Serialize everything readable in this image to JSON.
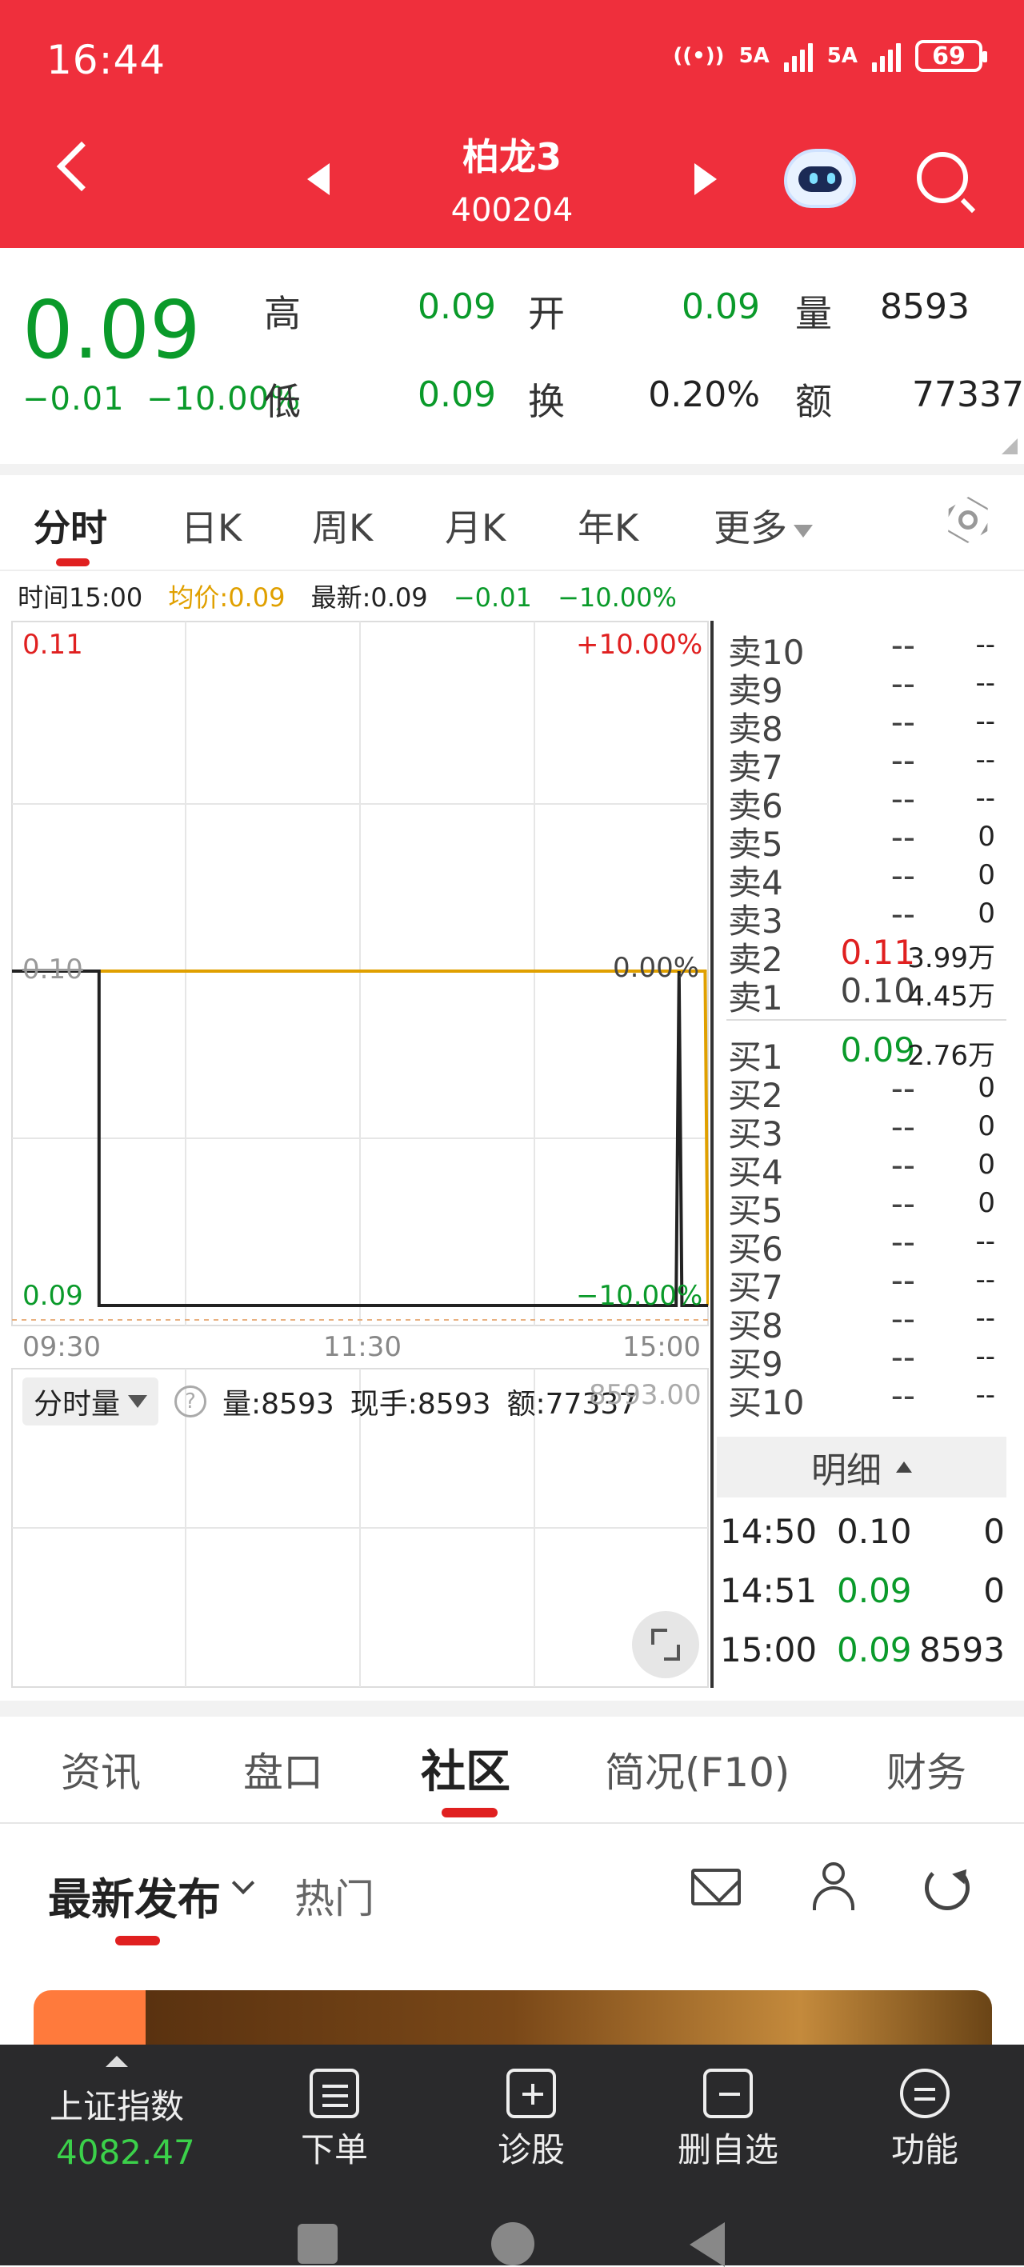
{
  "status": {
    "time": "16:44",
    "battery": "69",
    "net1": "5A",
    "net2": "5A"
  },
  "header": {
    "name": "柏龙3",
    "code": "400204"
  },
  "quote": {
    "price": "0.09",
    "change": "−0.01",
    "change_pct": "−10.00%",
    "high_label": "高",
    "high": "0.09",
    "low_label": "低",
    "low": "0.09",
    "open_label": "开",
    "open": "0.09",
    "turnover_label": "换",
    "turnover": "0.20%",
    "volume_label": "量",
    "volume": "8593",
    "amount_label": "额",
    "amount": "77337"
  },
  "ktabs": [
    "分时",
    "日K",
    "周K",
    "月K",
    "年K",
    "更多"
  ],
  "info": {
    "time": "时间15:00",
    "avg": "均价:0.09",
    "latest": "最新:0.09",
    "chg": "−0.01",
    "pct": "−10.00%"
  },
  "chart_labels": {
    "top_price": "0.11",
    "top_pct": "+10.00%",
    "mid_price": "0.10",
    "mid_pct": "0.00%",
    "bot_price": "0.09",
    "bot_pct": "−10.00%",
    "t_start": "09:30",
    "t_mid": "11:30",
    "t_end": "15:00"
  },
  "chart_data": {
    "type": "line",
    "x_range": [
      "09:30",
      "15:00"
    ],
    "ylim": [
      0.09,
      0.11
    ],
    "series": [
      {
        "name": "最新",
        "color": "#222222",
        "points": [
          [
            "09:30",
            0.1
          ],
          [
            "10:00",
            0.1
          ],
          [
            "10:00",
            0.09
          ],
          [
            "14:49",
            0.09
          ],
          [
            "14:50",
            0.1
          ],
          [
            "14:51",
            0.09
          ],
          [
            "15:00",
            0.09
          ]
        ]
      },
      {
        "name": "均价",
        "color": "#e0a000",
        "points": [
          [
            "10:00",
            0.1
          ],
          [
            "14:59",
            0.1
          ],
          [
            "15:00",
            0.09
          ]
        ]
      }
    ]
  },
  "volume": {
    "dropdown": "分时量",
    "vol": "量:8593",
    "hand": "现手:8593",
    "amt": "额:77337",
    "overlap": "8593.00"
  },
  "orderbook": {
    "asks": [
      {
        "label": "卖10",
        "price": "--",
        "vol": "--"
      },
      {
        "label": "卖9",
        "price": "--",
        "vol": "--"
      },
      {
        "label": "卖8",
        "price": "--",
        "vol": "--"
      },
      {
        "label": "卖7",
        "price": "--",
        "vol": "--"
      },
      {
        "label": "卖6",
        "price": "--",
        "vol": "--"
      },
      {
        "label": "卖5",
        "price": "--",
        "vol": "0"
      },
      {
        "label": "卖4",
        "price": "--",
        "vol": "0"
      },
      {
        "label": "卖3",
        "price": "--",
        "vol": "0"
      },
      {
        "label": "卖2",
        "price": "0.11",
        "vol": "3.99万"
      },
      {
        "label": "卖1",
        "price": "0.10",
        "vol": "4.45万"
      }
    ],
    "bids": [
      {
        "label": "买1",
        "price": "0.09",
        "vol": "2.76万"
      },
      {
        "label": "买2",
        "price": "--",
        "vol": "0"
      },
      {
        "label": "买3",
        "price": "--",
        "vol": "0"
      },
      {
        "label": "买4",
        "price": "--",
        "vol": "0"
      },
      {
        "label": "买5",
        "price": "--",
        "vol": "0"
      },
      {
        "label": "买6",
        "price": "--",
        "vol": "--"
      },
      {
        "label": "买7",
        "price": "--",
        "vol": "--"
      },
      {
        "label": "买8",
        "price": "--",
        "vol": "--"
      },
      {
        "label": "买9",
        "price": "--",
        "vol": "--"
      },
      {
        "label": "买10",
        "price": "--",
        "vol": "--"
      }
    ],
    "detail_label": "明细",
    "trades": [
      {
        "time": "14:50",
        "price": "0.10",
        "vol": "0"
      },
      {
        "time": "14:51",
        "price": "0.09",
        "vol": "0"
      },
      {
        "time": "15:00",
        "price": "0.09",
        "vol": "8593"
      }
    ]
  },
  "content_tabs": [
    "资讯",
    "盘口",
    "社区",
    "简况(F10)",
    "财务"
  ],
  "community": {
    "latest": "最新发布",
    "hot": "热门"
  },
  "bottom_nav": {
    "index_name": "上证指数",
    "index_value": "4082.47",
    "items": [
      "下单",
      "诊股",
      "删自选",
      "功能"
    ]
  },
  "colors": {
    "brand": "#ef2f3c",
    "up": "#e02020",
    "down": "#0a9a2a",
    "avg": "#e0a000"
  }
}
